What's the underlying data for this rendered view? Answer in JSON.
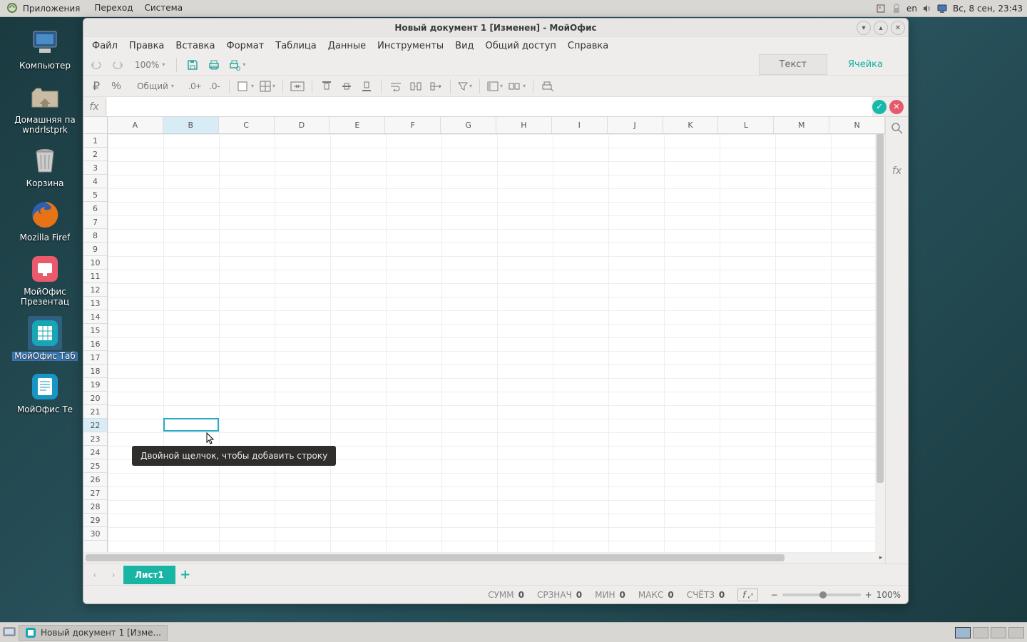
{
  "gnome_panel": {
    "menus": [
      "Приложения",
      "Переход",
      "Система"
    ],
    "lang": "en",
    "clock": "Вс,  8 сен, 23:43"
  },
  "desktop_icons": [
    {
      "label": "Компьютер",
      "icon": "computer"
    },
    {
      "label": "Домашняя па\nwndrlstprk",
      "icon": "home"
    },
    {
      "label": "Корзина",
      "icon": "trash"
    },
    {
      "label": "Mozilla Firef",
      "icon": "firefox"
    },
    {
      "label": "МойОфис Презентац",
      "icon": "present"
    },
    {
      "label": "МойОфис Таб",
      "icon": "table",
      "highlight": true
    },
    {
      "label": "МойОфис Те",
      "icon": "text"
    }
  ],
  "window": {
    "title": "Новый документ 1 [Изменен] - МойОфис",
    "min_icon": "▾",
    "max_icon": "▴",
    "close_icon": "✕"
  },
  "menubar": [
    "Файл",
    "Правка",
    "Вставка",
    "Формат",
    "Таблица",
    "Данные",
    "Инструменты",
    "Вид",
    "Общий доступ",
    "Справка"
  ],
  "tb1": {
    "zoom": "100%",
    "side_tabs": [
      {
        "label": "Текст",
        "active": false
      },
      {
        "label": "Ячейка",
        "active": true
      }
    ]
  },
  "tb2": {
    "number_format": "Общий"
  },
  "formula": {
    "fx": "fx"
  },
  "grid": {
    "columns": [
      "A",
      "B",
      "C",
      "D",
      "E",
      "F",
      "G",
      "H",
      "I",
      "J",
      "K",
      "L",
      "M",
      "N"
    ],
    "row_count": 30,
    "active_col_index": 1,
    "active_row_index": 21,
    "tooltip": "Двойной щелчок, чтобы добавить строку"
  },
  "sheet_tabs": {
    "active": "Лист1"
  },
  "statusbar": {
    "sum_label": "СУММ",
    "sum": "0",
    "avg_label": "СРЗНАЧ",
    "avg": "0",
    "min_label": "МИН",
    "min": "0",
    "max_label": "МАКС",
    "max": "0",
    "count_label": "СЧЁТЗ",
    "count": "0",
    "fn": "f",
    "zoom": "100%"
  },
  "taskbar": {
    "task_title": "Новый документ 1 [Изме..."
  }
}
